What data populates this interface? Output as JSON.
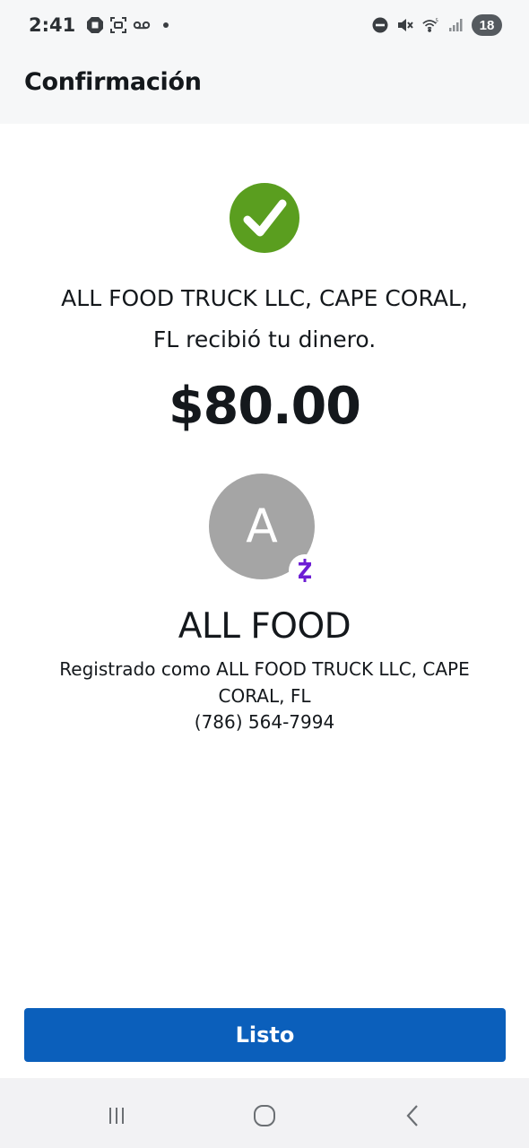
{
  "status_bar": {
    "time": "2:41",
    "left_icons": [
      "chase-icon",
      "screenshot-icon",
      "voicemail-icon"
    ],
    "right_icons": [
      "dnd-icon",
      "mute-icon",
      "wifi-icon",
      "signal-icon"
    ],
    "battery": "18"
  },
  "header": {
    "title": "Confirmación"
  },
  "confirmation": {
    "icon": "check-circle-icon",
    "icon_color": "#5a9e1f",
    "message_line1": "ALL FOOD TRUCK LLC, CAPE CORAL,",
    "message_line2": "FL recibió tu dinero.",
    "amount": "$80.00"
  },
  "recipient": {
    "initial": "A",
    "badge_icon": "zelle-icon",
    "badge_color": "#6d1ed4",
    "name": "ALL FOOD",
    "registered_line1": "Registrado como ALL FOOD TRUCK LLC, CAPE",
    "registered_line2": "CORAL, FL",
    "phone": "(786) 564-7994"
  },
  "actions": {
    "done_label": "Listo",
    "done_color": "#0b5fbb"
  },
  "nav_bar": {
    "items": [
      "recents-icon",
      "home-icon",
      "back-icon"
    ]
  }
}
